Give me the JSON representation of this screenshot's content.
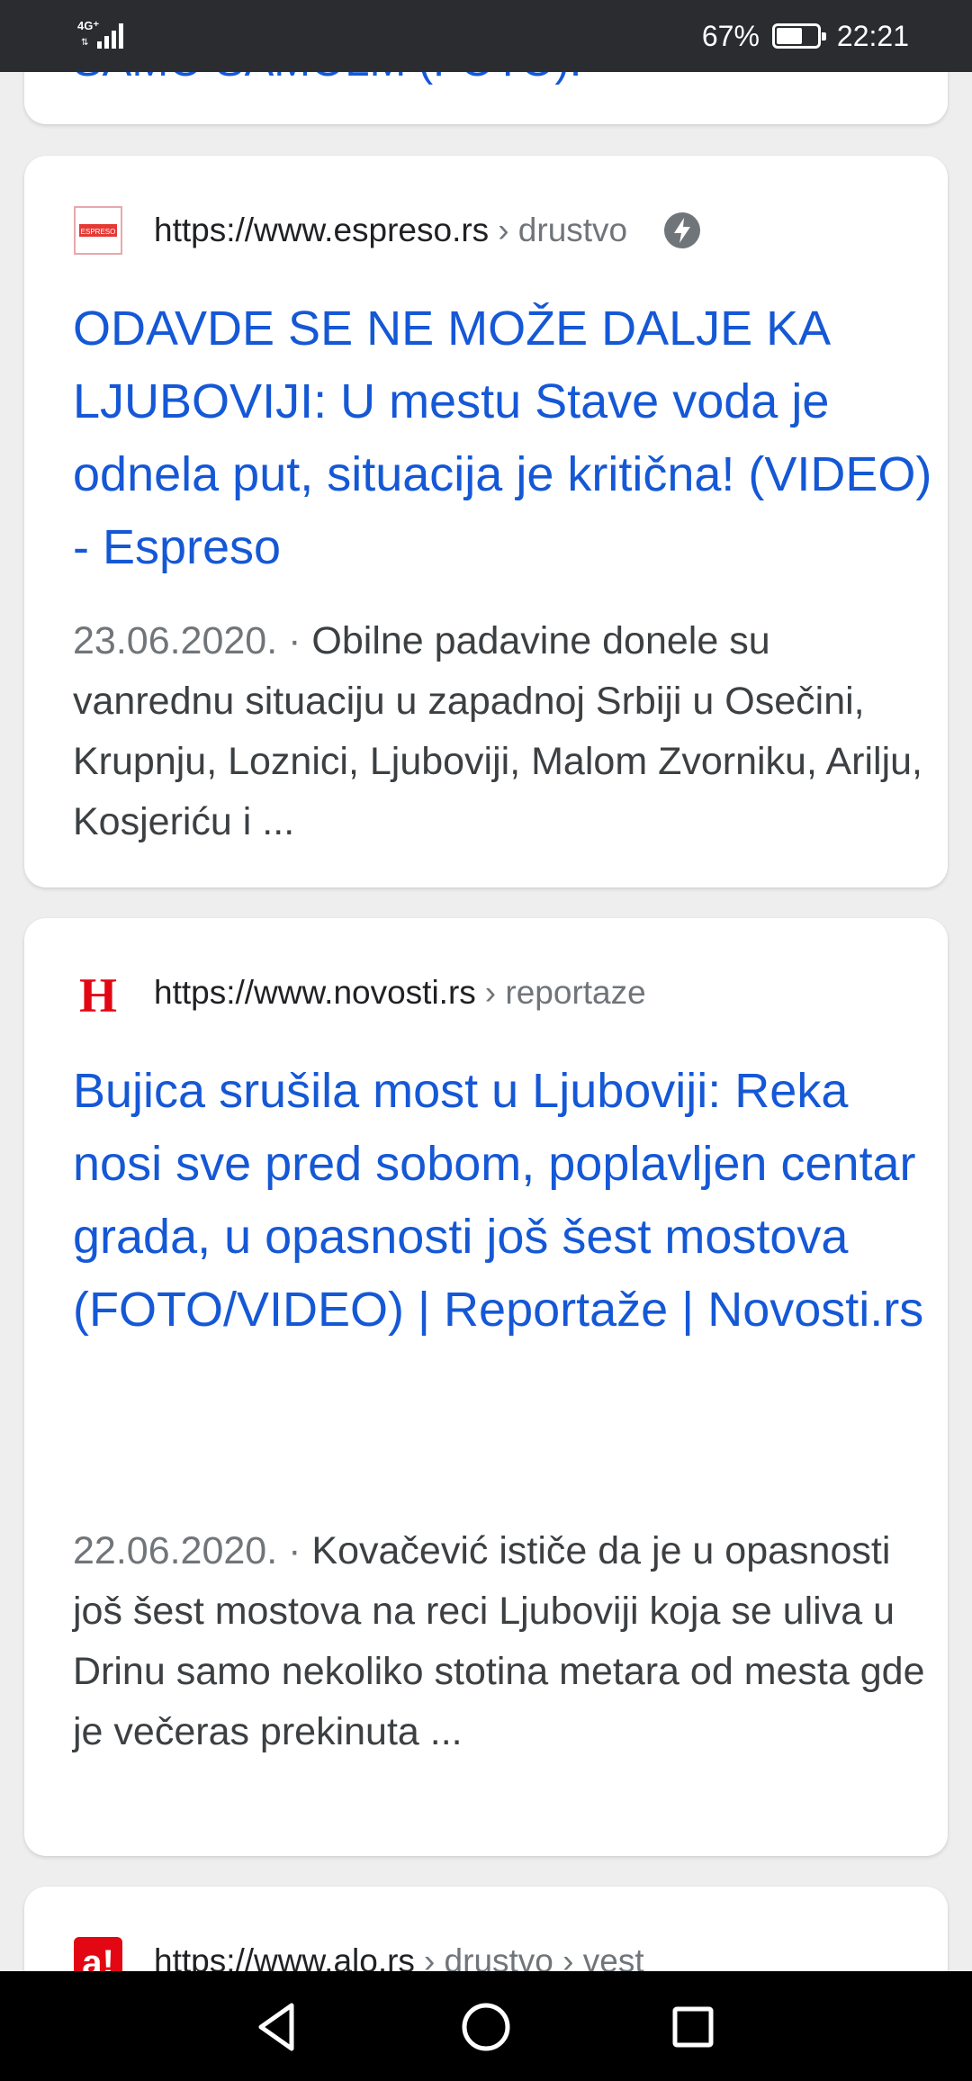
{
  "status_bar": {
    "network": "4G⁺",
    "battery_percent": "67%",
    "battery_level": 0.67,
    "time": "22:21"
  },
  "previous_result": {
    "title_tail": "SAMO SAMOLM (FOTO)."
  },
  "results": [
    {
      "url": "https://www.espreso.rs",
      "breadcrumb": "› drustvo",
      "favicon": "espreso-logo",
      "favicon_text": "ESPRESO",
      "has_amp": true,
      "title": "ODAVDE SE NE MOŽE DALJE KA LJUBOVIJI: U mestu Stave voda je odnela put, situacija je kritična! (VIDEO) - Espreso",
      "date": "23.06.2020.",
      "separator": "·",
      "snippet": "Obilne padavine donele su vanrednu situaciju u zapadnoj Srbiji u Osečini, Krupnju, Loznici, Ljuboviji, Malom Zvorniku, Arilju, Kosjeriću i ..."
    },
    {
      "url": "https://www.novosti.rs",
      "breadcrumb": "› reportaze",
      "favicon": "novosti-logo",
      "favicon_text": "H",
      "has_amp": false,
      "title": "Bujica srušila most u Ljuboviji: Reka nosi sve pred sobom, poplavljen centar grada, u opasnosti još šest mostova (FOTO/VIDEO) | Reportaže | Novosti.rs",
      "date": "22.06.2020.",
      "separator": "·",
      "snippet": "Kovačević ističe da je u opasnosti još šest mostova na reci Ljuboviji koja se uliva u Drinu samo nekoliko stotina metara od mesta gde je večeras prekinuta ..."
    },
    {
      "url": "https://www.alo.rs",
      "breadcrumb": "› drustvo › vest",
      "favicon": "alo-logo",
      "favicon_text": "a!"
    }
  ],
  "colors": {
    "link_blue": "#1558d6",
    "status_bar_bg": "#2b2c2f",
    "nav_bar_bg": "#000000",
    "page_bg": "#eeeeef"
  }
}
